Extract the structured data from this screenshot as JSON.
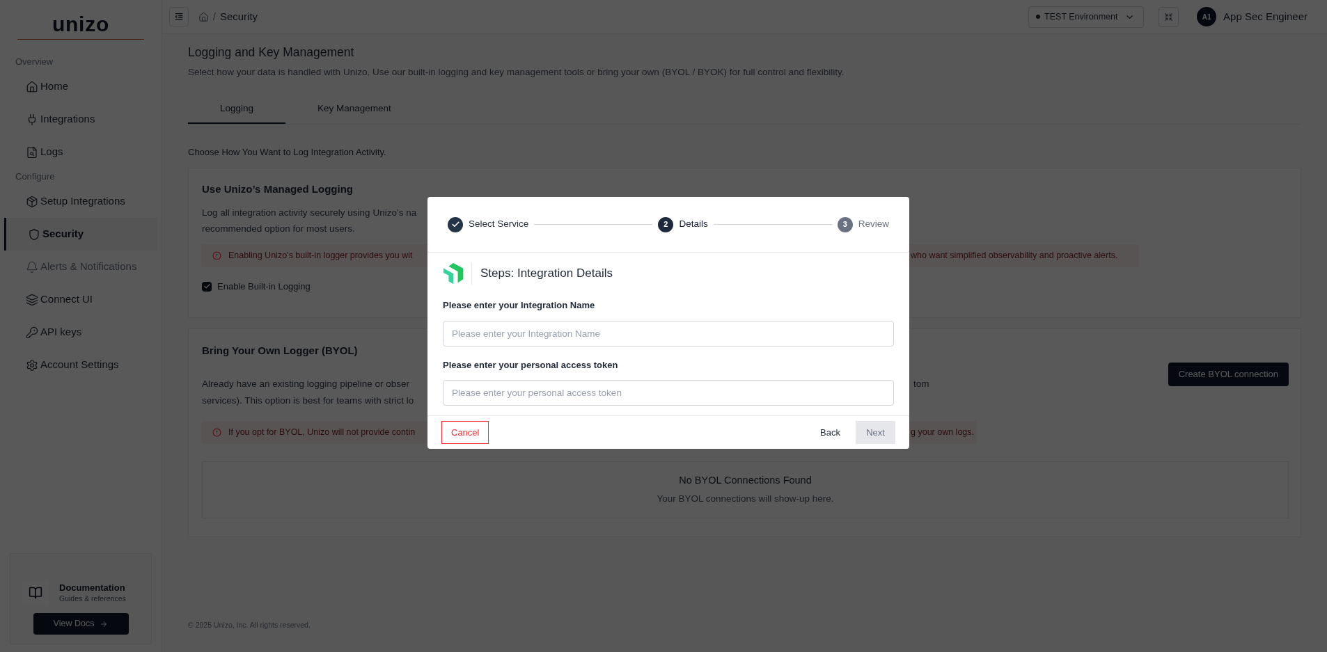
{
  "sidebar": {
    "logo": "unizo",
    "sections": [
      {
        "title": "Overview",
        "items": [
          {
            "label": "Home",
            "selected": false,
            "disabled": false
          },
          {
            "label": "Integrations",
            "selected": false,
            "disabled": false
          },
          {
            "label": "Logs",
            "selected": false,
            "disabled": false
          }
        ]
      },
      {
        "title": "Configure",
        "items": [
          {
            "label": "Setup Integrations",
            "selected": false,
            "disabled": false
          },
          {
            "label": "Security",
            "selected": true,
            "disabled": false
          },
          {
            "label": "Alerts & Notifications",
            "selected": false,
            "disabled": true
          },
          {
            "label": "Connect UI",
            "selected": false,
            "disabled": false
          },
          {
            "label": "API keys",
            "selected": false,
            "disabled": false
          },
          {
            "label": "Account Settings",
            "selected": false,
            "disabled": false
          }
        ]
      }
    ],
    "doc_card": {
      "title": "Documentation",
      "subtitle": "Guides & references",
      "button": "View Docs"
    }
  },
  "header": {
    "separator": "/",
    "breadcrumb": "Security",
    "environment": "TEST Environment",
    "user": {
      "initials": "A1",
      "name": "App Sec Engineer"
    }
  },
  "page": {
    "title": "Logging and Key Management",
    "subtitle": "Select how your data is handled with Unizo. Use our built-in logging and key management tools or bring your own (BYOL / BYOK) for full control and flexibility.",
    "tabs": [
      {
        "label": "Logging",
        "selected": true
      },
      {
        "label": "Key Management",
        "selected": false
      }
    ],
    "prompt": "Choose How You Want to Log Integration Activity.",
    "managed": {
      "title": "Use Unizo’s Managed Logging",
      "lines": [
        {
          "left": "Log all integration activity securely using Unizo’s na"
        },
        {
          "left": "recommended option for most users."
        }
      ],
      "alert": {
        "left": "Enabling Unizo’s built-in logger provides you wit",
        "right": "who want simplified observability and proactive alerts."
      },
      "checkbox": {
        "label": "Enable Built-in Logging",
        "checked": true
      }
    },
    "byol": {
      "title": "Bring Your Own Logger (BYOL)",
      "button": "Create BYOL connection",
      "lines": [
        {
          "left": "Already have an existing logging pipeline or obser",
          "right": "tom"
        },
        {
          "left": "services). This option is best for teams with strict lo"
        }
      ],
      "alert": {
        "left": "If you opt for BYOL, Unizo will not provide contin",
        "right": "g your own logs."
      },
      "empty": {
        "title": "No BYOL Connections Found",
        "text": "Your BYOL connections will show-up here."
      }
    }
  },
  "footer": "© 2025 Unizo, Inc. All rights reserved.",
  "modal": {
    "steps": [
      {
        "label": "Select Service",
        "completed": true,
        "selected": false
      },
      {
        "number": "2",
        "label": "Details",
        "completed": false,
        "selected": true
      },
      {
        "number": "3",
        "label": "Review",
        "completed": false,
        "selected": false
      }
    ],
    "heading": "Steps: Integration Details",
    "fields": [
      {
        "label": "Please enter your Integration Name",
        "placeholder": "Please enter your Integration Name"
      },
      {
        "label": "Please enter your personal access token",
        "placeholder": "Please enter your personal access token"
      }
    ],
    "cancel": "Cancel",
    "back": "Back",
    "next": {
      "label": "Next",
      "disabled": true
    }
  }
}
